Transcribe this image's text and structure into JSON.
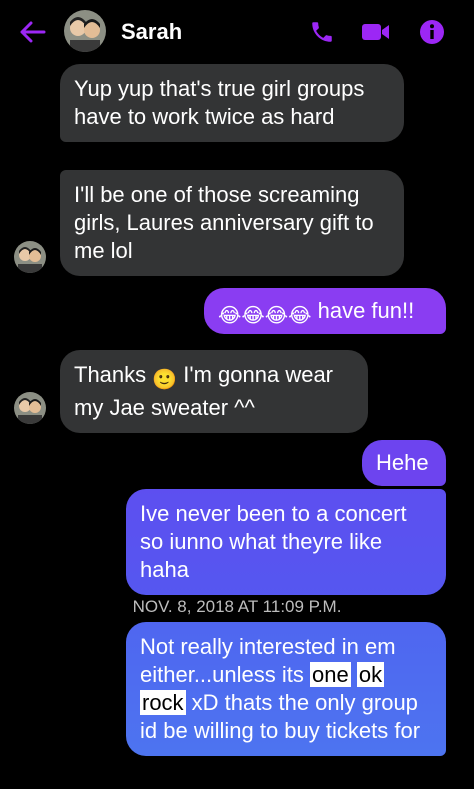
{
  "header": {
    "contact_name": "Sarah",
    "back_icon": "arrow-left-icon",
    "call_icon": "phone-icon",
    "video_icon": "video-camera-icon",
    "info_icon": "info-icon",
    "accent_color": "#9c27f5"
  },
  "messages": {
    "m1": "Yup yup that's true girl groups have to work twice as hard",
    "m2": "I'll be one of those screaming girls, Laures anniversary gift to me lol",
    "m3_text": " have fun!!",
    "m3_emoji": "😂😂😂😂",
    "m4_pre": "Thanks ",
    "m4_emoji": "🙂",
    "m4_post": " I'm gonna wear my Jae sweater ^^",
    "m5": "Hehe",
    "m6": "Ive never been to a concert so iunno what theyre like haha",
    "timestamp": "NOV. 8, 2018 AT 11:09 P.M.",
    "m7_a": "Not really interested in em either...unless its ",
    "m7_h1": "one",
    "m7_h2": "ok",
    "m7_h3": "rock",
    "m7_b": " xD thats the only group id be willing to buy tickets for"
  },
  "colors": {
    "incoming_bubble": "#333435",
    "outgoing_purple": "#8a3df2",
    "outgoing_blue": "#4e6ef0"
  }
}
